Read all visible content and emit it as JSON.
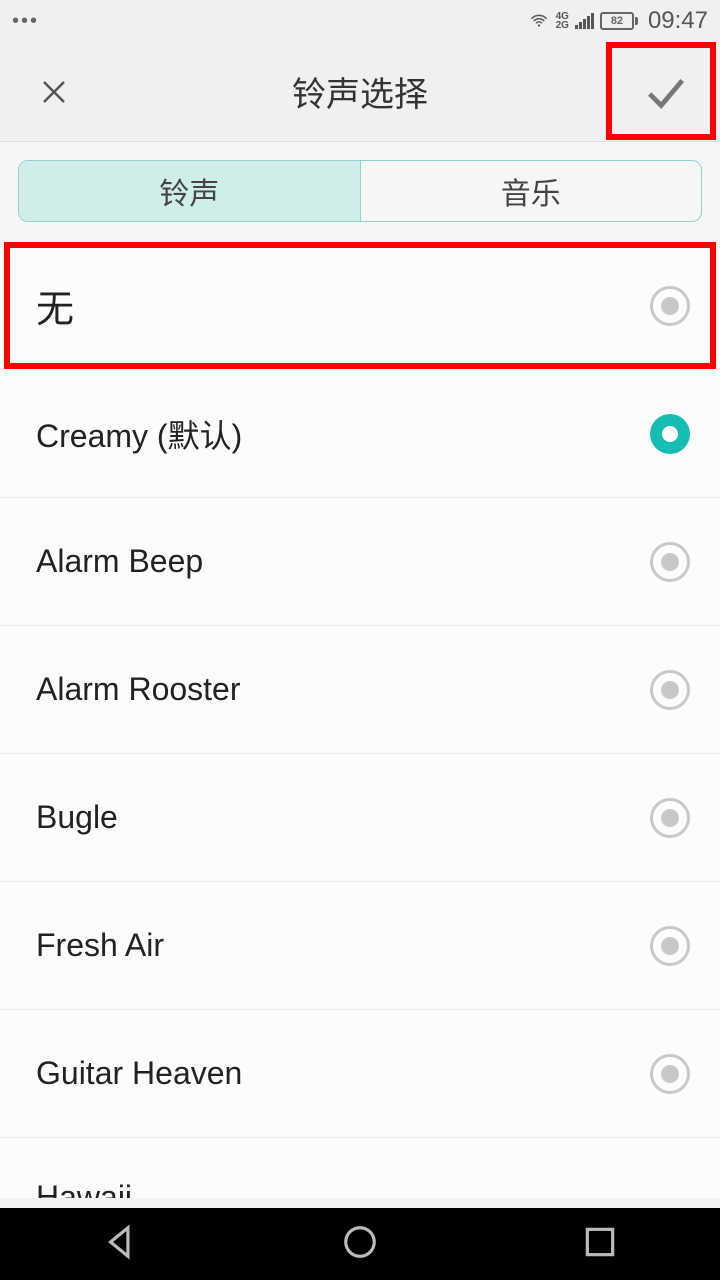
{
  "status": {
    "network1": "4G",
    "network2": "2G",
    "battery": "82",
    "time": "09:47"
  },
  "header": {
    "title": "铃声选择"
  },
  "tabs": [
    {
      "label": "铃声",
      "active": true
    },
    {
      "label": "音乐",
      "active": false
    }
  ],
  "ringtones": [
    {
      "label": "无",
      "selected": false,
      "highlighted": true
    },
    {
      "label": "Creamy (默认)",
      "selected": true
    },
    {
      "label": "Alarm Beep",
      "selected": false
    },
    {
      "label": "Alarm Rooster",
      "selected": false
    },
    {
      "label": "Bugle",
      "selected": false
    },
    {
      "label": "Fresh Air",
      "selected": false
    },
    {
      "label": "Guitar Heaven",
      "selected": false
    },
    {
      "label": "Hawaii",
      "selected": false,
      "partial": true
    }
  ],
  "annotations": {
    "confirm_highlighted": true
  }
}
